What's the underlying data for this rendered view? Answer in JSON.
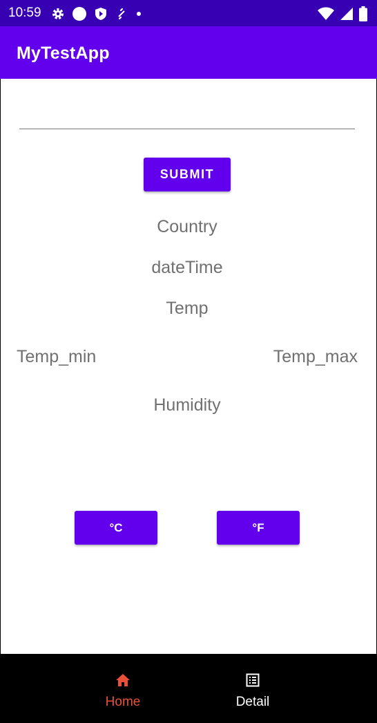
{
  "status_bar": {
    "time": "10:59",
    "icons_left": [
      "gear-icon",
      "circle-icon",
      "shield-icon",
      "link-icon",
      "dot-icon"
    ],
    "icons_right": [
      "wifi-icon",
      "signal-icon",
      "battery-icon"
    ]
  },
  "app_bar": {
    "title": "MyTestApp"
  },
  "form": {
    "city_value": "",
    "city_placeholder": "",
    "submit_label": "SUBMIT"
  },
  "weather": {
    "country": "Country",
    "date_time": "dateTime",
    "temp": "Temp",
    "temp_min": "Temp_min",
    "temp_max": "Temp_max",
    "humidity": "Humidity"
  },
  "units": {
    "celsius_label": "°C",
    "fahrenheit_label": "°F"
  },
  "bottom_nav": {
    "items": [
      {
        "label": "Home",
        "icon": "home-icon",
        "active": true
      },
      {
        "label": "Detail",
        "icon": "list-icon",
        "active": false
      }
    ]
  },
  "colors": {
    "status_bar": "#3700b3",
    "primary": "#6200ee",
    "nav_active": "#e8503a",
    "label_text": "#707070"
  }
}
